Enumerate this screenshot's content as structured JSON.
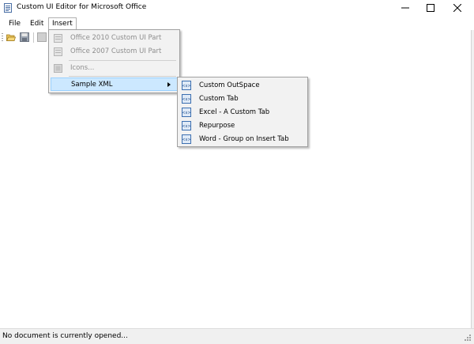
{
  "window": {
    "title": "Custom UI Editor for Microsoft Office"
  },
  "menubar": {
    "items": [
      {
        "label": "File"
      },
      {
        "label": "Edit"
      },
      {
        "label": "Insert"
      }
    ]
  },
  "insert_menu": {
    "items": [
      {
        "label": "Office 2010 Custom UI Part",
        "enabled": false
      },
      {
        "label": "Office 2007 Custom UI Part",
        "enabled": false
      },
      {
        "label": "Icons...",
        "enabled": false
      },
      {
        "label": "Sample XML",
        "enabled": true,
        "has_submenu": true
      }
    ]
  },
  "sample_xml_submenu": {
    "items": [
      {
        "label": "Custom OutSpace"
      },
      {
        "label": "Custom Tab"
      },
      {
        "label": "Excel - A Custom Tab"
      },
      {
        "label": "Repurpose"
      },
      {
        "label": "Word - Group on Insert Tab"
      }
    ]
  },
  "statusbar": {
    "text": "No document is currently opened..."
  },
  "colors": {
    "highlight_bg": "#cce8ff",
    "highlight_border": "#99d1ff",
    "menu_bg": "#f2f2f2",
    "disabled_text": "#8d8d8d"
  }
}
